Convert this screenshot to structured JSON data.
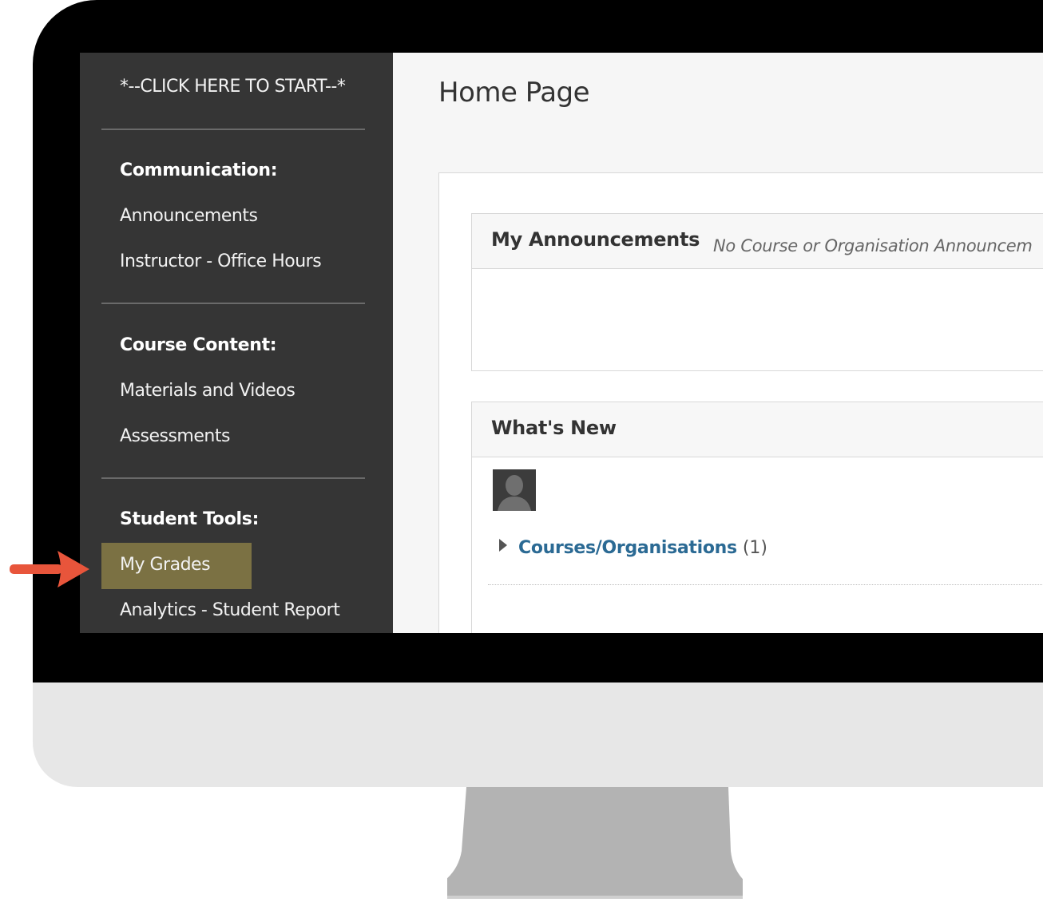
{
  "sidebar": {
    "start_link": "*--CLICK HERE TO START--*",
    "sections": [
      {
        "heading": "Communication:",
        "items": [
          "Announcements",
          "Instructor - Office Hours"
        ]
      },
      {
        "heading": "Course Content:",
        "items": [
          "Materials and Videos",
          "Assessments"
        ]
      },
      {
        "heading": "Student Tools:",
        "items": [
          "My Grades",
          "Analytics - Student Report"
        ]
      }
    ],
    "highlighted_item": "My Grades"
  },
  "main": {
    "page_title": "Home Page",
    "announcements": {
      "title": "My Announcements",
      "empty_message": "No Course or Organisation Announcem"
    },
    "whats_new": {
      "title": "What's New",
      "course_link": "Courses/Organisations",
      "course_count": "(1)"
    }
  },
  "colors": {
    "sidebar_bg": "#353535",
    "highlight": "#7b7143",
    "link": "#2b6a94",
    "arrow": "#e8553b"
  },
  "icons": [
    "avatar-icon",
    "caret-right-icon",
    "arrow-right-icon"
  ]
}
